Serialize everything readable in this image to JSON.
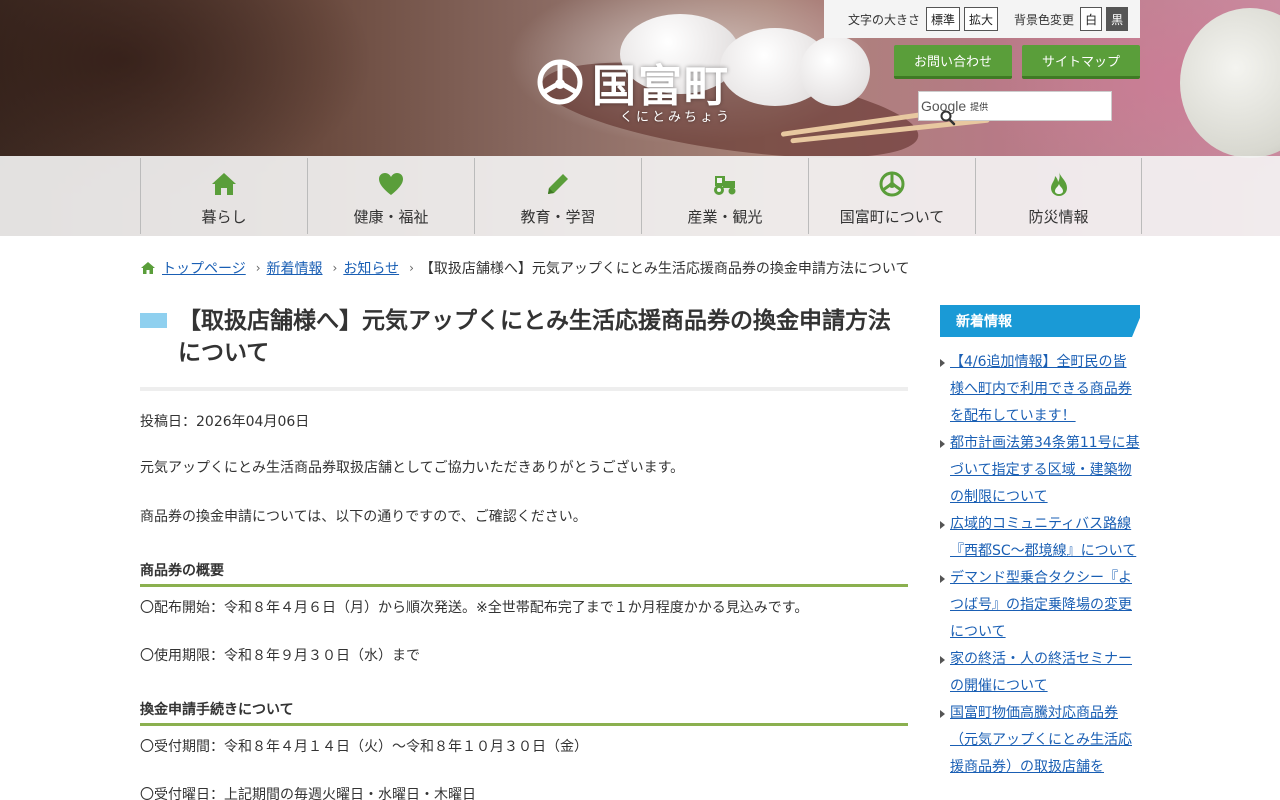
{
  "utility": {
    "font_size_label": "文字の大きさ",
    "font_normal": "標準",
    "font_large": "拡大",
    "bg_label": "背景色変更",
    "bg_white": "白",
    "bg_black": "黒"
  },
  "logo": {
    "name": "国富町",
    "reading": "くにとみちょう"
  },
  "header_buttons": {
    "contact": "お問い合わせ",
    "sitemap": "サイトマップ"
  },
  "search": {
    "google": "Google",
    "provided": "提供"
  },
  "nav": {
    "items": [
      {
        "label": "暮らし",
        "icon": "home-icon"
      },
      {
        "label": "健康・福祉",
        "icon": "heart-icon"
      },
      {
        "label": "教育・学習",
        "icon": "pencil-icon"
      },
      {
        "label": "産業・観光",
        "icon": "tractor-icon"
      },
      {
        "label": "国富町について",
        "icon": "town-emblem-icon"
      },
      {
        "label": "防災情報",
        "icon": "flame-icon"
      }
    ]
  },
  "breadcrumb": {
    "home": "トップページ",
    "news": "新着情報",
    "notice": "お知らせ",
    "current": "【取扱店舗様へ】元気アップくにとみ生活応援商品券の換金申請方法について"
  },
  "article": {
    "title": "【取扱店舗様へ】元気アップくにとみ生活応援商品券の換金申請方法について",
    "post_date": "投稿日：2026年04月06日",
    "intro1": "元気アップくにとみ生活商品券取扱店舗としてご協力いただきありがとうございます。",
    "intro2": "商品券の換金申請については、以下の通りですので、ご確認ください。",
    "section1_title": "商品券の概要",
    "section1_p1": "〇配布開始：令和８年４月６日（月）から順次発送。※全世帯配布完了まで１か月程度かかる見込みです。",
    "section1_p2": "〇使用期限：令和８年９月３０日（水）まで",
    "section2_title": "換金申請手続きについて",
    "section2_p1": "〇受付期間：令和８年４月１４日（火）～令和８年１０月３０日（金）",
    "section2_p2": "〇受付曜日：上記期間の毎週火曜日・水曜日・木曜日"
  },
  "sidebar": {
    "heading": "新着情報",
    "items": [
      "【4/6追加情報】全町民の皆様へ町内で利用できる商品券を配布しています！",
      "都市計画法第34条第11号に基づいて指定する区域・建築物の制限について",
      "広域的コミュニティバス路線『西都SC～郡境線』について",
      "デマンド型乗合タクシー『よつば号』の指定乗降場の変更について",
      "家の終活・人の終活セミナーの開催について",
      "国富町物価高騰対応商品券（元気アップくにとみ生活応援商品券）の取扱店舗を"
    ]
  },
  "colors": {
    "green": "#5a9e3a",
    "blue": "#1a9ad6",
    "link": "#1a5fb4",
    "heading_rule": "#8bb04f"
  }
}
